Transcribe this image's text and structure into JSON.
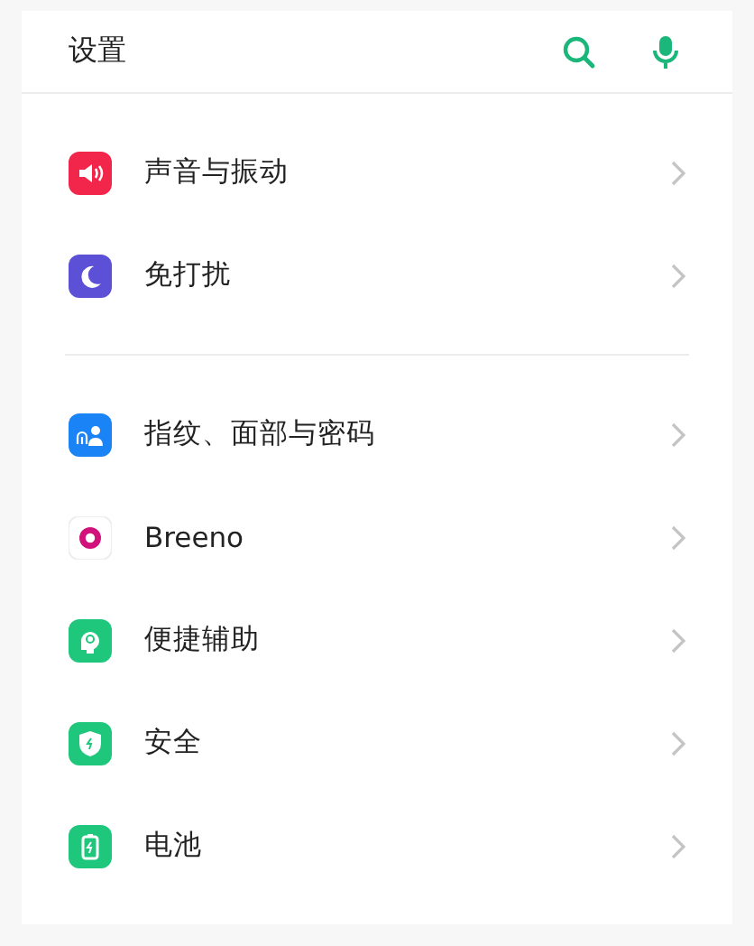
{
  "header": {
    "title": "设置"
  },
  "groups": [
    {
      "items": [
        {
          "label": "声音与振动",
          "kind": "sound"
        },
        {
          "label": "免打扰",
          "kind": "moon"
        }
      ]
    },
    {
      "items": [
        {
          "label": "指纹、面部与密码",
          "kind": "biometric"
        },
        {
          "label": "Breeno",
          "kind": "ring"
        },
        {
          "label": "便捷辅助",
          "kind": "assist"
        },
        {
          "label": "安全",
          "kind": "shield"
        },
        {
          "label": "电池",
          "kind": "battery"
        }
      ]
    }
  ]
}
